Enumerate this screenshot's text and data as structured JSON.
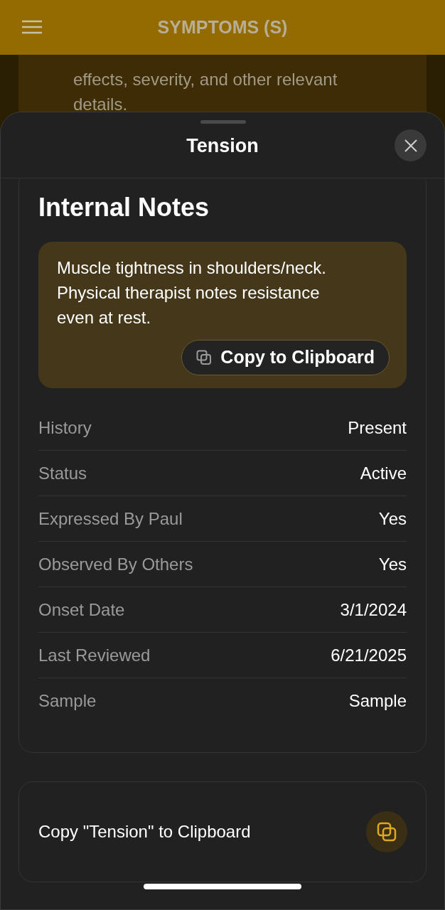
{
  "app_bar": {
    "title": "SYMPTOMS (S)"
  },
  "background_text": "effects, severity, and other relevant details.",
  "sheet": {
    "title": "Tension",
    "section_title": "Internal Notes",
    "note": "Muscle tightness in shoulders/neck. Physical therapist notes resistance even at rest.",
    "note_button": "Copy to Clipboard",
    "fields": [
      {
        "label": "History",
        "value": "Present"
      },
      {
        "label": "Status",
        "value": "Active"
      },
      {
        "label": "Expressed By Paul",
        "value": "Yes"
      },
      {
        "label": "Observed By Others",
        "value": "Yes"
      },
      {
        "label": "Onset Date",
        "value": "3/1/2024"
      },
      {
        "label": "Last Reviewed",
        "value": "6/21/2025"
      },
      {
        "label": "Sample",
        "value": "Sample"
      }
    ],
    "copy_action": "Copy \"Tension\" to Clipboard"
  }
}
